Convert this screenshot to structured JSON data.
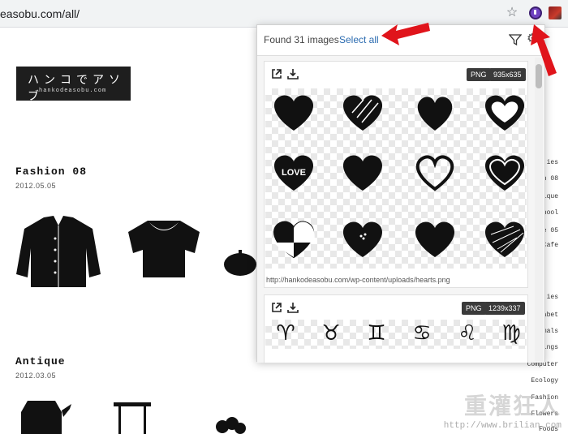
{
  "browser": {
    "url": "easobu.com/all/"
  },
  "site": {
    "logo_main": "ハンコでアソブ",
    "logo_sub": "hankodeasobu.com",
    "posts": [
      {
        "title": "Fashion 08",
        "date": "2012.05.05"
      },
      {
        "title": "Antique",
        "date": "2012.03.05"
      }
    ],
    "side_nav": [
      "ies",
      "n 08",
      "ique",
      "hool",
      "e 05",
      "Cafe",
      "ies",
      "abet",
      "mals",
      "ings",
      "Computer",
      "Ecology",
      "Fashion",
      "Flowers",
      "Foods"
    ]
  },
  "popup": {
    "found_text": "Found 31 images",
    "select_all": "Select all",
    "cards": [
      {
        "format": "PNG",
        "size": "935x635",
        "url": "http://hankodeasobu.com/wp-content/uploads/hearts.png",
        "love_text": "LOVE"
      },
      {
        "format": "PNG",
        "size": "1239x337",
        "zodiac": [
          "♈",
          "♉",
          "♊",
          "♋",
          "♌",
          "♍"
        ]
      }
    ]
  },
  "watermark": {
    "main": "重灌狂人",
    "sub": "http://www.brilian.com"
  },
  "colors": {
    "accent_link": "#2b6bb0",
    "arrow_red": "#e0141b",
    "badge_bg": "#3a3a3a"
  }
}
